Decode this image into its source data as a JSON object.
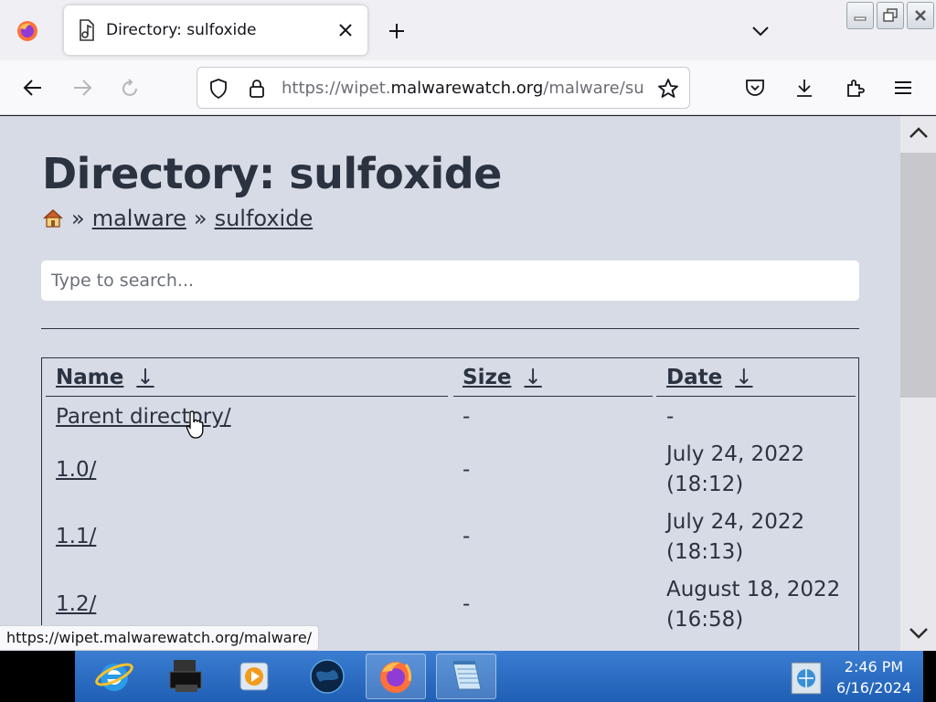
{
  "browser": {
    "tab": {
      "title": "Directory: sulfoxide"
    },
    "url": {
      "prefix": "https://wipet.",
      "host": "malwarewatch.org",
      "path": "/malware/su"
    },
    "status_link": "https://wipet.malwarewatch.org/malware/"
  },
  "page": {
    "title": "Directory: sulfoxide",
    "breadcrumb": {
      "home_icon": "house-icon",
      "separator": "»",
      "items": [
        "malware",
        "sulfoxide"
      ]
    },
    "search_placeholder": "Type to search...",
    "table": {
      "headers": [
        {
          "label": "Name",
          "arrow": "↓"
        },
        {
          "label": "Size",
          "arrow": "↓"
        },
        {
          "label": "Date",
          "arrow": "↓"
        }
      ],
      "rows": [
        {
          "name": "Parent directory/",
          "size": "-",
          "date1": "-",
          "date2": ""
        },
        {
          "name": "1.0/",
          "size": "-",
          "date1": "July 24, 2022",
          "date2": "(18:12)"
        },
        {
          "name": "1.1/",
          "size": "-",
          "date1": "July 24, 2022",
          "date2": "(18:13)"
        },
        {
          "name": "1.2/",
          "size": "-",
          "date1": "August 18, 2022",
          "date2": "(16:58)"
        }
      ]
    }
  },
  "taskbar": {
    "items": [
      "internet-explorer-icon",
      "printer-icon",
      "media-player-icon",
      "globe-icon",
      "firefox-icon",
      "notepad-icon"
    ],
    "clock": {
      "time": "2:46 PM",
      "date": "6/16/2024"
    }
  }
}
